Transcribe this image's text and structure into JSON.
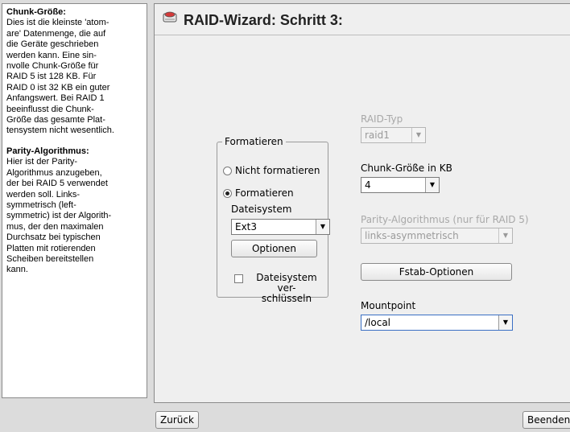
{
  "help": {
    "sections": [
      {
        "heading": "Chunk-Größe:",
        "text": "Dies ist die kleinste 'atom-\nare' Datenmenge, die auf\ndie Geräte geschrieben\nwerden kann. Eine sin-\nnvolle Chunk-Größe für\nRAID 5 ist 128 KB. Für\nRAID 0 ist 32 KB ein guter\nAnfangswert. Bei RAID 1\nbeeinflusst die Chunk-\nGröße das gesamte Plat-\ntensystem nicht wesentlich."
      },
      {
        "heading": "Parity-Algorithmus:",
        "text": "Hier ist der Parity-\nAlgorithmus anzugeben,\nder bei RAID 5 verwendet\nwerden soll. Links-\nsymmetrisch (left-\nsymmetric) ist der Algorith-\nmus, der den maximalen\nDurchsatz bei typischen\nPlatten mit rotierenden\nScheiben bereitstellen\nkann."
      }
    ]
  },
  "title": "RAID-Wizard: Schritt 3:",
  "format_group": {
    "label": "Formatieren",
    "radio_no_format": "Nicht formatieren",
    "radio_format": "Formatieren",
    "filesystem_label": "Dateisystem",
    "filesystem_value": "Ext3",
    "options_button": "Optionen",
    "encrypt_label_line1": "Dateisystem ver-",
    "encrypt_label_line2": "schlüsseln"
  },
  "raid_type": {
    "label": "RAID-Typ",
    "value": "raid1"
  },
  "chunk_size": {
    "label": "Chunk-Größe in KB",
    "value": "4"
  },
  "parity": {
    "label": "Parity-Algorithmus (nur für RAID 5)",
    "value": "links-asymmetrisch"
  },
  "fstab_button": "Fstab-Optionen",
  "mountpoint": {
    "label": "Mountpoint",
    "value": "/local"
  },
  "nav": {
    "back": "Zurück",
    "finish": "Beenden"
  },
  "icons": {
    "title_icon": "harddisk-icon",
    "dropdown": "chevron-down-icon"
  }
}
